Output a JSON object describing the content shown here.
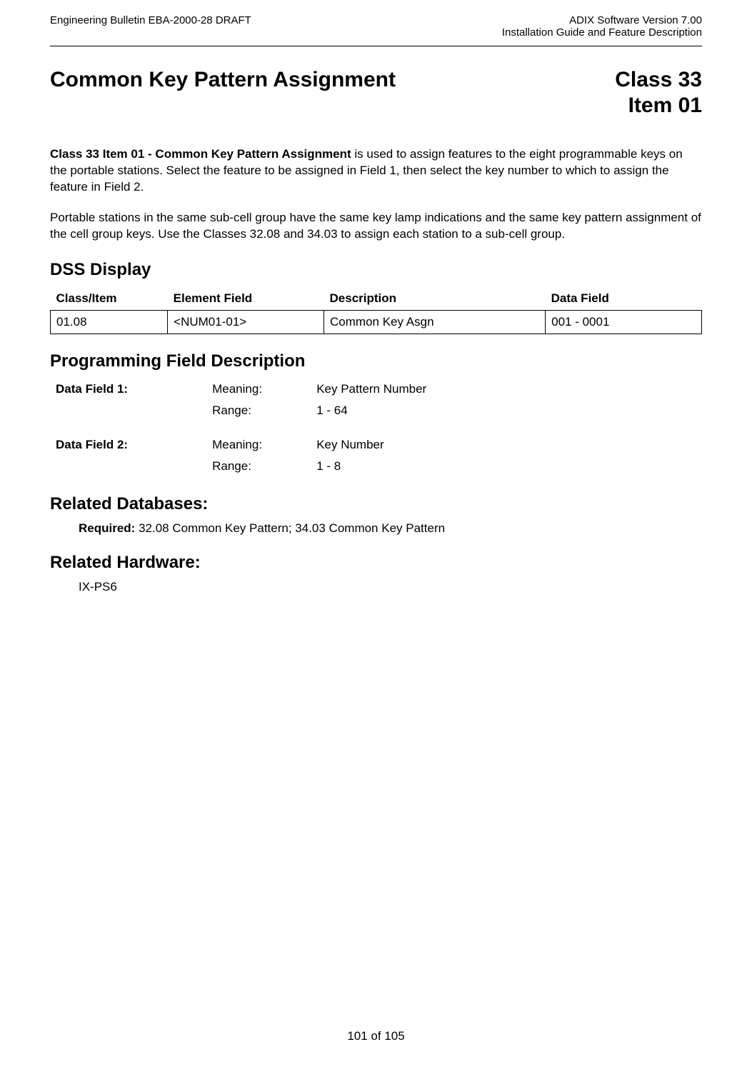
{
  "header": {
    "left": "Engineering Bulletin EBA-2000-28 DRAFT",
    "right_line1": "ADIX Software Version 7.00",
    "right_line2": "Installation Guide and Feature Description"
  },
  "title": {
    "main": "Common Key Pattern Assignment",
    "class": "Class 33",
    "item": "Item 01"
  },
  "intro": {
    "bold_lead": "Class 33 Item 01 - Common Key Pattern Assignment",
    "rest": " is used to assign features to the eight programmable keys on the portable stations.  Select the feature to be assigned in Field 1, then select the key number to which to assign the feature in Field 2."
  },
  "para2": "Portable stations in the same sub-cell group have the same key lamp indications and the same key pattern assignment of the cell group keys.  Use the Classes 32.08 and 34.03 to assign each station to a sub-cell group.",
  "dss": {
    "heading": "DSS Display",
    "headers": {
      "class_item": "Class/Item",
      "element_field": "Element Field",
      "description": "Description",
      "data_field": "Data Field"
    },
    "row": {
      "class_item": "01.08",
      "element_field": "<NUM01-01>",
      "description": "Common Key Asgn",
      "data_field": "001 - 0001"
    }
  },
  "programming": {
    "heading": "Programming Field Description",
    "field1": {
      "label": "Data Field 1:",
      "meaning_label": "Meaning:",
      "meaning_value": "Key Pattern Number",
      "range_label": "Range:",
      "range_value": "1 - 64"
    },
    "field2": {
      "label": "Data Field 2:",
      "meaning_label": "Meaning:",
      "meaning_value": "Key Number",
      "range_label": "Range:",
      "range_value": "1 - 8"
    }
  },
  "related_db": {
    "heading": "Related Databases:",
    "required_label": "Required:  ",
    "required_value": "32.08 Common Key Pattern; 34.03 Common Key Pattern"
  },
  "related_hw": {
    "heading": "Related Hardware:",
    "value": "IX-PS6"
  },
  "footer": "101 of 105"
}
